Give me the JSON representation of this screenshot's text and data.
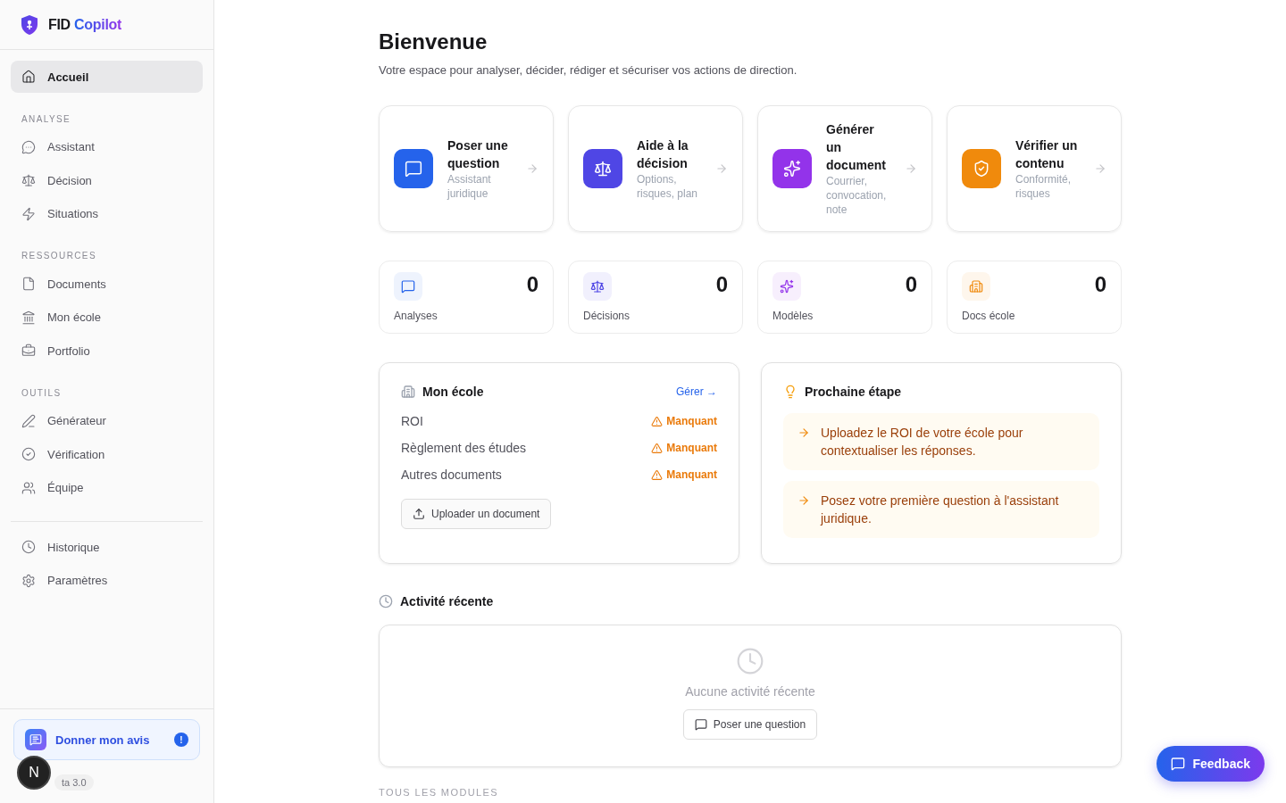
{
  "brand": {
    "name": "FID",
    "accent": "Copilot"
  },
  "sidebar": {
    "sections": [
      {
        "items": [
          {
            "label": "Accueil",
            "selected": true
          }
        ]
      },
      {
        "title": "ANALYSE",
        "items": [
          {
            "label": "Assistant",
            "selected": false
          },
          {
            "label": "Décision",
            "selected": false
          },
          {
            "label": "Situations",
            "selected": false
          }
        ]
      },
      {
        "title": "RESSOURCES",
        "items": [
          {
            "label": "Documents",
            "selected": false
          },
          {
            "label": "Mon école",
            "selected": false
          },
          {
            "label": "Portfolio",
            "selected": false
          }
        ]
      },
      {
        "title": "OUTILS",
        "items": [
          {
            "label": "Générateur",
            "selected": false
          },
          {
            "label": "Vérification",
            "selected": false
          },
          {
            "label": "Équipe",
            "selected": false
          }
        ]
      },
      {
        "divider": true,
        "items": [
          {
            "label": "Historique",
            "selected": false
          },
          {
            "label": "Paramètres",
            "selected": false
          }
        ]
      }
    ],
    "feedback": {
      "label": "Donner mon avis",
      "badge": "!"
    },
    "dev_badge": "N",
    "version": "ta 3.0"
  },
  "page": {
    "title": "Bienvenue",
    "subtitle": "Votre espace pour analyser, décider, rédiger et sécuriser vos actions de direction."
  },
  "actions": [
    {
      "title": "Poser une question",
      "subtitle": "Assistant juridique",
      "color": "#2563eb"
    },
    {
      "title": "Aide à la décision",
      "subtitle": "Options, risques, plan",
      "color": "#4f46e5"
    },
    {
      "title": "Générer un document",
      "subtitle": "Courrier, convocation, note",
      "color": "#9333ea"
    },
    {
      "title": "Vérifier un contenu",
      "subtitle": "Conformité, risques",
      "color": "#f08a0c"
    }
  ],
  "stats": [
    {
      "label": "Analyses",
      "value": "0",
      "color": "#2563eb"
    },
    {
      "label": "Décisions",
      "value": "0",
      "color": "#4f46e5"
    },
    {
      "label": "Modèles",
      "value": "0",
      "color": "#9333ea"
    },
    {
      "label": "Docs école",
      "value": "0",
      "color": "#f08a0c"
    }
  ],
  "school": {
    "title": "Mon école",
    "link": "Gérer →",
    "rows": [
      {
        "name": "ROI",
        "status": "Manquant"
      },
      {
        "name": "Règlement des études",
        "status": "Manquant"
      },
      {
        "name": "Autres documents",
        "status": "Manquant"
      }
    ],
    "button": "Uploader un document"
  },
  "next_steps": {
    "title": "Prochaine étape",
    "items": [
      "Uploadez le ROI de votre école pour contextualiser les réponses.",
      "Posez votre première question à l'assistant juridique."
    ]
  },
  "activity": {
    "title": "Activité récente",
    "empty": "Aucune activité récente",
    "button": "Poser une question"
  },
  "modules_label": "TOUS LES MODULES",
  "feedback_button": "Feedback"
}
